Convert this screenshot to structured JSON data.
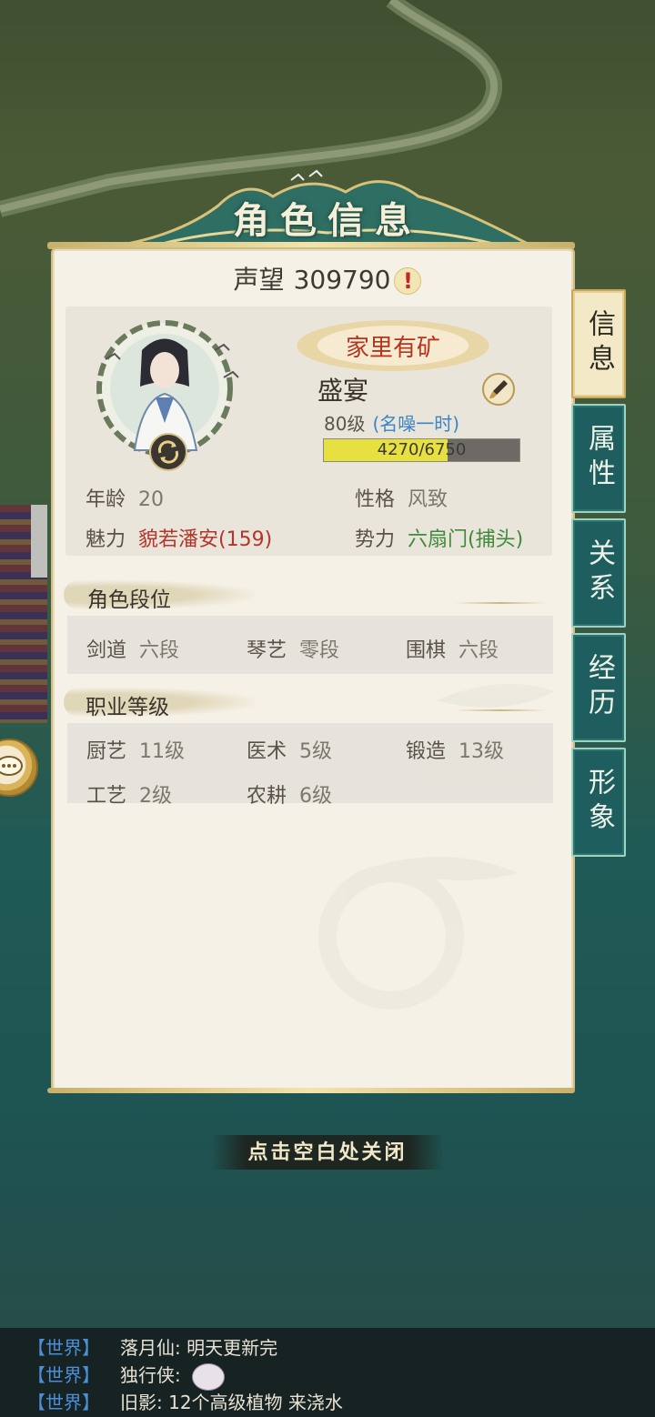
{
  "header": {
    "title": "角色信息"
  },
  "prestige": {
    "label": "声望",
    "value": "309790",
    "alert_glyph": "!"
  },
  "character": {
    "title_badge": "家里有矿",
    "name": "盛宴",
    "level": "80级",
    "fame": "(名噪一时)",
    "exp_text": "4270/6750",
    "exp_fraction": 0.633,
    "stats": {
      "age_label": "年龄",
      "age_value": "20",
      "personality_label": "性格",
      "personality_value": "风致",
      "charm_label": "魅力",
      "charm_value": "貌若潘安(159)",
      "faction_label": "势力",
      "faction_value": "六扇门(捕头)"
    }
  },
  "ranks": {
    "title": "角色段位",
    "items": [
      {
        "label": "剑道",
        "value": "六段"
      },
      {
        "label": "琴艺",
        "value": "零段"
      },
      {
        "label": "围棋",
        "value": "六段"
      }
    ]
  },
  "professions": {
    "title": "职业等级",
    "items": [
      {
        "label": "厨艺",
        "value": "11级"
      },
      {
        "label": "医术",
        "value": "5级"
      },
      {
        "label": "锻造",
        "value": "13级"
      },
      {
        "label": "工艺",
        "value": "2级"
      },
      {
        "label": "农耕",
        "value": "6级"
      }
    ]
  },
  "tabs": [
    {
      "label": "信息",
      "active": true
    },
    {
      "label": "属性",
      "active": false
    },
    {
      "label": "关系",
      "active": false
    },
    {
      "label": "经历",
      "active": false
    },
    {
      "label": "形象",
      "active": false
    }
  ],
  "close_hint": "点击空白处关闭",
  "chat": [
    {
      "channel": "【世界】",
      "text": "落月仙: 明天更新完"
    },
    {
      "channel": "【世界】",
      "text": "独行侠:"
    },
    {
      "channel": "【世界】",
      "text": "旧影: 12个高级植物 来浇水"
    }
  ],
  "colors": {
    "accent_red": "#b4352a",
    "accent_green": "#3f8a3b",
    "fame_blue": "#3d84c4",
    "exp_fill": "#e7e041",
    "tab_teal": "#1f5e5e"
  }
}
